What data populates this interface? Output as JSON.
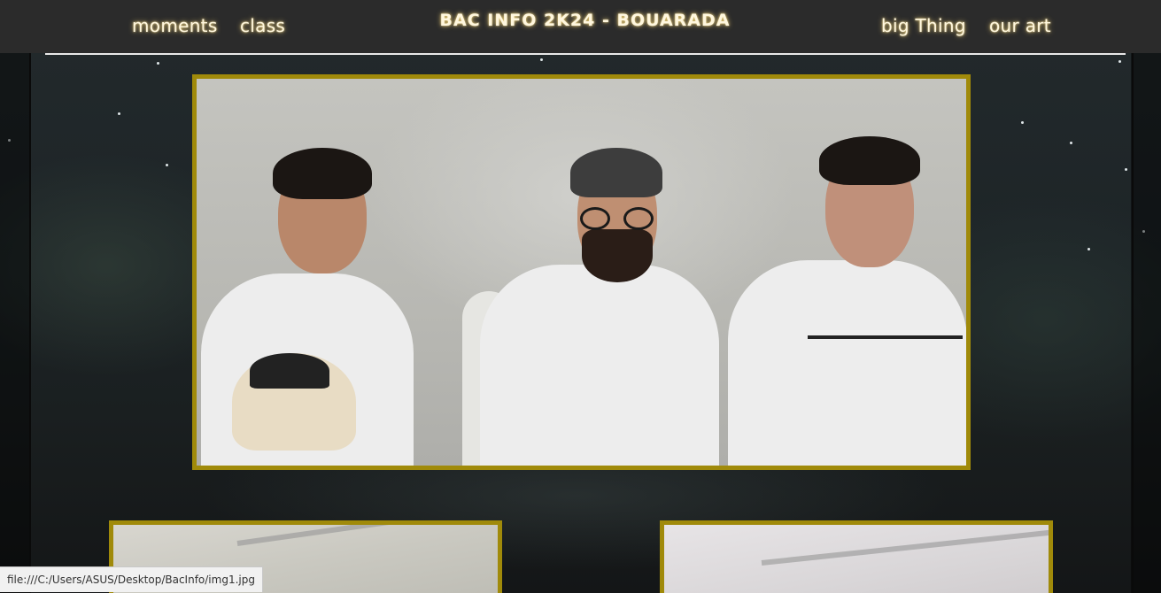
{
  "nav": {
    "left": [
      "moments",
      "class"
    ],
    "right": [
      "big Thing",
      "our art"
    ]
  },
  "site_title": "BAC INFO 2K24 - BOUARADA",
  "status_bar": {
    "url": "file:///C:/Users/ASUS/Desktop/BacInfo/img1.jpg"
  },
  "colors": {
    "frame_border": "#a08a0a",
    "header_bg": "#2b2b2b",
    "nav_text": "#fff7de"
  }
}
